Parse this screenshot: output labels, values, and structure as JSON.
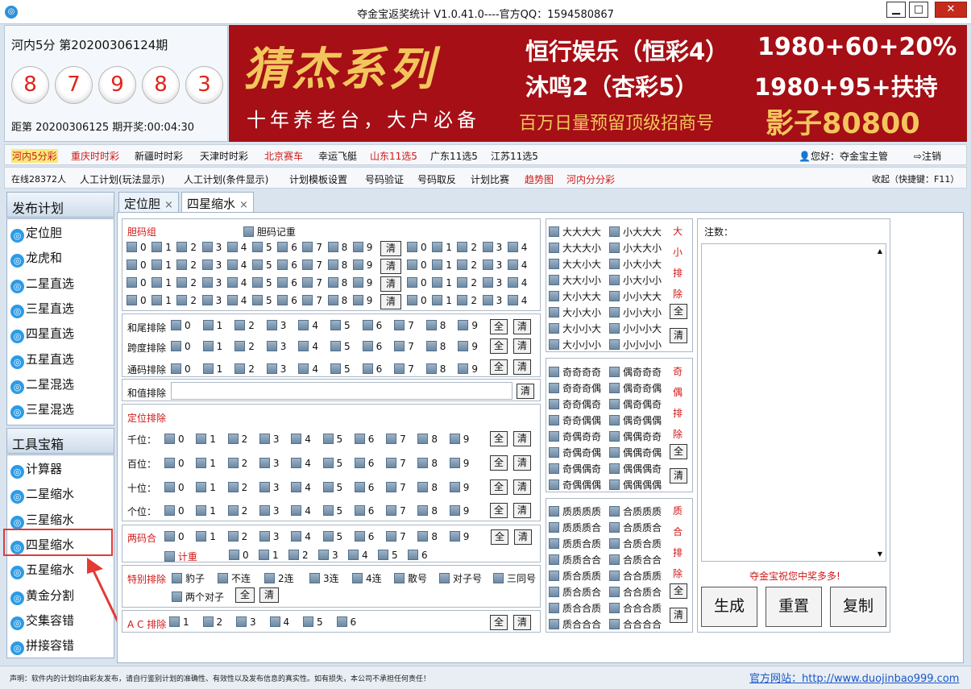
{
  "window": {
    "title": "夺金宝返奖统计  V1.0.41.0----官方QQ：1594580867",
    "minimize": "▁",
    "maximize": "□",
    "close": "✕"
  },
  "lottery": {
    "name": "河内5分  第20200306124期",
    "balls": [
      "8",
      "7",
      "9",
      "8",
      "3"
    ],
    "next": "距第 20200306125 期开奖:00:04:30"
  },
  "banner": {
    "series": "猜杰系列",
    "slogan": "十年养老台，大户必备",
    "line1a": "恒行娱乐（恒彩4）",
    "line1b": "1980+60+20%",
    "line2a": "沐鸣2（杏彩5）",
    "line2b": "1980+95+扶持",
    "line3a": "百万日量预留顶级招商号",
    "line3b": "影子80800"
  },
  "nav1": {
    "items": [
      {
        "label": "河内5分彩",
        "color": "#d01818",
        "active": true
      },
      {
        "label": "重庆时时彩",
        "color": "#d01818"
      },
      {
        "label": "新疆时时彩",
        "color": "#111111"
      },
      {
        "label": "天津时时彩",
        "color": "#111111"
      },
      {
        "label": "北京赛车",
        "color": "#d01818"
      },
      {
        "label": "幸运飞艇",
        "color": "#111111"
      },
      {
        "label": "山东11选5",
        "color": "#d01818"
      },
      {
        "label": "广东11选5",
        "color": "#111111"
      },
      {
        "label": "江苏11选5",
        "color": "#111111"
      }
    ],
    "greeting": "您好：夺金宝主管",
    "logout": "注销"
  },
  "nav2": {
    "online": "在线28372人",
    "items": [
      {
        "label": "人工计划(玩法显示)",
        "color": "#111111"
      },
      {
        "label": "人工计划(条件显示)",
        "color": "#111111"
      },
      {
        "label": "计划模板设置",
        "color": "#111111"
      },
      {
        "label": "号码验证",
        "color": "#111111"
      },
      {
        "label": "号码取反",
        "color": "#111111"
      },
      {
        "label": "计划比赛",
        "color": "#111111"
      },
      {
        "label": "趋势图",
        "color": "#d01818"
      },
      {
        "label": "河内分分彩",
        "color": "#d01818"
      }
    ],
    "collapse": "收起（快捷键：F11）"
  },
  "sidebar": {
    "plan_title": "发布计划",
    "plan_items": [
      "定位胆",
      "龙虎和",
      "二星直选",
      "三星直选",
      "四星直选",
      "五星直选",
      "二星混选",
      "三星混选"
    ],
    "tools_title": "工具宝箱",
    "tool_items": [
      "计算器",
      "二星缩水",
      "三星缩水",
      "四星缩水",
      "五星缩水",
      "黄金分割",
      "交集容错",
      "拼接容错"
    ]
  },
  "tabs": [
    {
      "label": "定位胆",
      "close": "×"
    },
    {
      "label": "四星缩水",
      "close": "×"
    }
  ],
  "digits": [
    "0",
    "1",
    "2",
    "3",
    "4",
    "5",
    "6",
    "7",
    "8",
    "9"
  ],
  "digits5": [
    "0",
    "1",
    "2",
    "3",
    "4"
  ],
  "digits_ac": [
    "1",
    "2",
    "3",
    "4",
    "5",
    "6"
  ],
  "labels": {
    "all": "全",
    "clear": "清",
    "dan_group": "胆码组",
    "dan_repeat": "胆码记重",
    "tail": "和尾排除",
    "span": "跨度排除",
    "common": "通码排除",
    "sum": "和值排除",
    "pos_ex": "定位排除",
    "qian": "千位：",
    "bai": "百位：",
    "shi": "十位：",
    "ge": "个位：",
    "two_code": "两码合",
    "count_repeat": "计重",
    "special": "特别排除",
    "ac": "A C 排除",
    "note": "注数：",
    "wish": "夺金宝祝您中奖多多!",
    "generate": "生成",
    "reset": "重置",
    "copy": "复制"
  },
  "special": [
    "豹子",
    "不连",
    "2连",
    "3连",
    "4连",
    "散号",
    "对子号",
    "三同号",
    "两个对子"
  ],
  "big_small": {
    "items": [
      "大大大大",
      "小大大大",
      "大大大小",
      "小大大小",
      "大大小大",
      "小大小大",
      "大大小小",
      "小大小小",
      "大小大大",
      "小小大大",
      "大小大小",
      "小小大小",
      "大小小大",
      "小小小大",
      "大小小小",
      "小小小小"
    ],
    "side": [
      "大",
      "小",
      "排",
      "除"
    ]
  },
  "odd_even": {
    "items": [
      "奇奇奇奇",
      "偶奇奇奇",
      "奇奇奇偶",
      "偶奇奇偶",
      "奇奇偶奇",
      "偶奇偶奇",
      "奇奇偶偶",
      "偶奇偶偶",
      "奇偶奇奇",
      "偶偶奇奇",
      "奇偶奇偶",
      "偶偶奇偶",
      "奇偶偶奇",
      "偶偶偶奇",
      "奇偶偶偶",
      "偶偶偶偶"
    ],
    "side": [
      "奇",
      "偶",
      "排",
      "除"
    ]
  },
  "prime": {
    "items": [
      "质质质质",
      "合质质质",
      "质质质合",
      "合质质合",
      "质质合质",
      "合质合质",
      "质质合合",
      "合质合合",
      "质合质质",
      "合合质质",
      "质合质合",
      "合合质合",
      "质合合质",
      "合合合质",
      "质合合合",
      "合合合合"
    ],
    "side": [
      "质",
      "合",
      "排",
      "除"
    ]
  },
  "status": {
    "disclaimer": "声明：软件内的计划均由彩友发布，请自行鉴别计划的准确性、有效性以及发布信息的真实性。如有损失，本公司不承担任何责任！",
    "website": "官方网站：http://www.duojinbao999.com"
  },
  "colors": {
    "accent": "#d01818",
    "banner": "#a50f15",
    "banner_gold": "#f3c65d",
    "link": "#1a56c8"
  }
}
